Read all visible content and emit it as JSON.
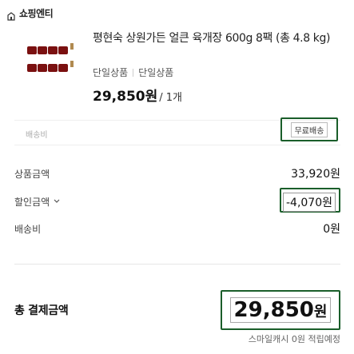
{
  "store": {
    "name": "쇼핑엔티",
    "icon": "store-icon"
  },
  "product": {
    "title": "평현숙 상원가든 얼큰 육개장 600g 8팩 (총 4.8 kg)",
    "options": [
      "단일상품",
      "단일상품"
    ],
    "price": "29,850원",
    "quantity": "/ 1개",
    "thumbnail_icon": "product-thumbnail"
  },
  "shipping": {
    "label": "배송비",
    "badge": "무료배송"
  },
  "summary": {
    "product_amount_label": "상품금액",
    "product_amount_value": "33,920원",
    "discount_label": "할인금액",
    "discount_value": "-4,070원",
    "shipping_label": "배송비",
    "shipping_value": "0원"
  },
  "total": {
    "label": "총 결제금액",
    "value": "29,850",
    "unit": "원",
    "mileage": "스마일캐시 0원 적립예정"
  },
  "colors": {
    "highlight_border": "#1a5e2a"
  }
}
